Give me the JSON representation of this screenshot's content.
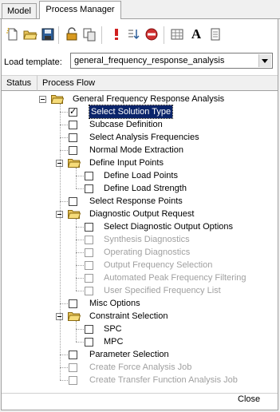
{
  "tabs": [
    {
      "label": "Model"
    },
    {
      "label": "Process Manager"
    }
  ],
  "toolbar": {
    "icons": [
      "new-icon",
      "open-folder-icon",
      "save-icon",
      "lock-icon",
      "copy-icon",
      "alert-icon",
      "list-icon",
      "stop-icon",
      "grid-icon",
      "font-icon",
      "document-icon"
    ]
  },
  "template": {
    "label": "Load template:",
    "value": "general_frequency_response_analysis"
  },
  "columns": {
    "status": "Status",
    "flow": "Process Flow"
  },
  "tree": [
    {
      "label": "General Frequency Response Analysis",
      "type": "folder",
      "level": 0
    },
    {
      "label": "Select Solution Type",
      "type": "check",
      "level": 1,
      "checked": true,
      "selected": true
    },
    {
      "label": "Subcase Definition",
      "type": "check",
      "level": 1
    },
    {
      "label": "Select Analysis Frequencies",
      "type": "check",
      "level": 1
    },
    {
      "label": "Normal Mode Extraction",
      "type": "check",
      "level": 1
    },
    {
      "label": "Define Input Points",
      "type": "folder",
      "level": 1
    },
    {
      "label": "Define Load Points",
      "type": "check",
      "level": 2
    },
    {
      "label": "Define Load Strength",
      "type": "check",
      "level": 2
    },
    {
      "label": "Select Response Points",
      "type": "check",
      "level": 1
    },
    {
      "label": "Diagnostic Output Request",
      "type": "folder",
      "level": 1
    },
    {
      "label": "Select Diagnostic Output Options",
      "type": "check",
      "level": 2
    },
    {
      "label": "Synthesis Diagnostics",
      "type": "check",
      "level": 2,
      "disabled": true
    },
    {
      "label": "Operating Diagnostics",
      "type": "check",
      "level": 2,
      "disabled": true
    },
    {
      "label": "Output Frequency Selection",
      "type": "check",
      "level": 2,
      "disabled": true
    },
    {
      "label": "Automated Peak Frequency Filtering",
      "type": "check",
      "level": 2,
      "disabled": true
    },
    {
      "label": "User Specified Frequency List",
      "type": "check",
      "level": 2,
      "disabled": true
    },
    {
      "label": "Misc Options",
      "type": "check",
      "level": 1
    },
    {
      "label": "Constraint Selection",
      "type": "folder",
      "level": 1
    },
    {
      "label": "SPC",
      "type": "check",
      "level": 2
    },
    {
      "label": "MPC",
      "type": "check",
      "level": 2
    },
    {
      "label": "Parameter Selection",
      "type": "check",
      "level": 1
    },
    {
      "label": "Create Force Analysis Job",
      "type": "check",
      "level": 1,
      "disabled": true
    },
    {
      "label": "Create Transfer Function Analysis Job",
      "type": "check",
      "level": 1,
      "disabled": true
    }
  ],
  "footer": {
    "close_label": "Close"
  }
}
